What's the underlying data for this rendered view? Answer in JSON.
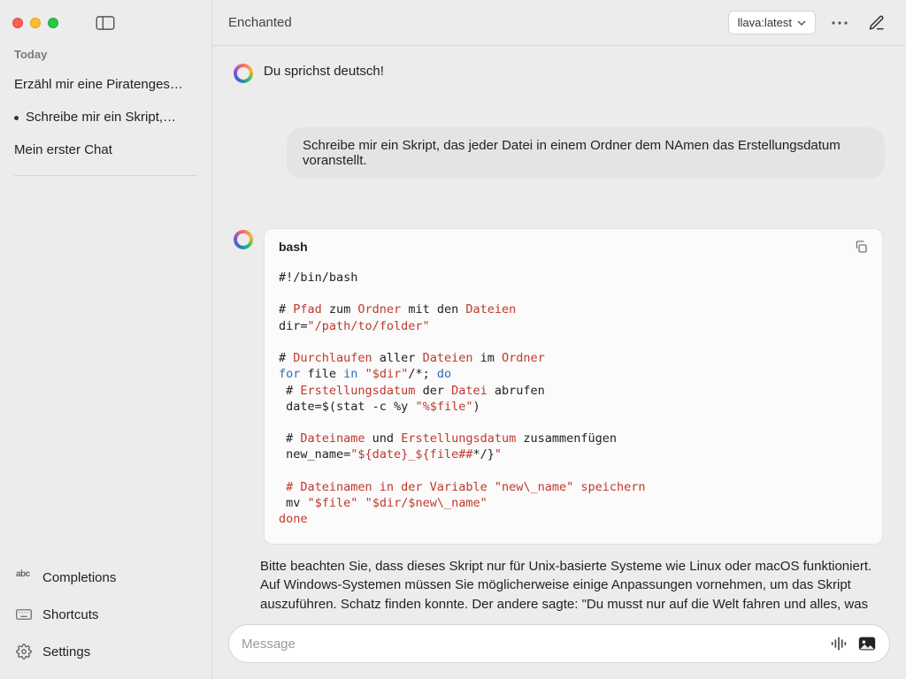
{
  "sidebar": {
    "section_label": "Today",
    "chats": [
      {
        "title": "Erzähl mir eine Piratenges…",
        "dot": false
      },
      {
        "title": "Schreibe mir ein Skript,…",
        "dot": true
      },
      {
        "title": "Mein erster Chat",
        "dot": false
      }
    ],
    "bottom": {
      "completions": "Completions",
      "shortcuts": "Shortcuts",
      "settings": "Settings"
    }
  },
  "topbar": {
    "title": "Enchanted",
    "model": "llava:latest"
  },
  "conversation": {
    "assistant_intro": "Du sprichst deutsch!",
    "user_prompt": "Schreibe mir ein Skript, das jeder Datei in einem Ordner dem NAmen das Erstellungsdatum voranstellt.",
    "code_lang": "bash",
    "code": {
      "l1": "#!/bin/bash",
      "l2a": "# ",
      "l2b": "Pfad",
      "l2c": " zum ",
      "l2d": "Ordner",
      "l2e": " mit den ",
      "l2f": "Dateien",
      "l3a": "dir=",
      "l3b": "\"/path/to/folder\"",
      "l4a": "# ",
      "l4b": "Durchlaufen",
      "l4c": " aller ",
      "l4d": "Dateien",
      "l4e": " im ",
      "l4f": "Ordner",
      "l5a": "for",
      "l5b": " file ",
      "l5c": "in",
      "l5d": " ",
      "l5e": "\"$dir\"",
      "l5f": "/*; ",
      "l5g": "do",
      "l6a": " # ",
      "l6b": "Erstellungsdatum",
      "l6c": " der ",
      "l6d": "Datei",
      "l6e": " abrufen",
      "l7a": " date=$(stat -c %y ",
      "l7b": "\"%$file\"",
      "l7c": ")",
      "l8a": " # ",
      "l8b": "Dateiname",
      "l8c": " und ",
      "l8d": "Erstellungsdatum",
      "l8e": " zusammenfügen",
      "l9a": " new_name=",
      "l9b": "\"${date}_${file##",
      "l9c": "*/}",
      "l9d": "\"",
      "l10": " # Dateinamen in der Variable \"new\\_name\" speichern",
      "l11a": " mv ",
      "l11b": "\"$file\"",
      "l11c": " ",
      "l11d": "\"$dir/$new\\_name\"",
      "l12": "done"
    },
    "followup": "Bitte beachten Sie, dass dieses Skript nur für Unix-basierte Systeme wie Linux oder macOS funktioniert. Auf Windows-Systemen müssen Sie möglicherweise einige Anpassungen vornehmen, um das Skript auszuführen.  Schatz finden konnte. Der andere sagte: \"Du musst nur auf die Welt fahren und alles, was du"
  },
  "composer": {
    "placeholder": "Message"
  }
}
